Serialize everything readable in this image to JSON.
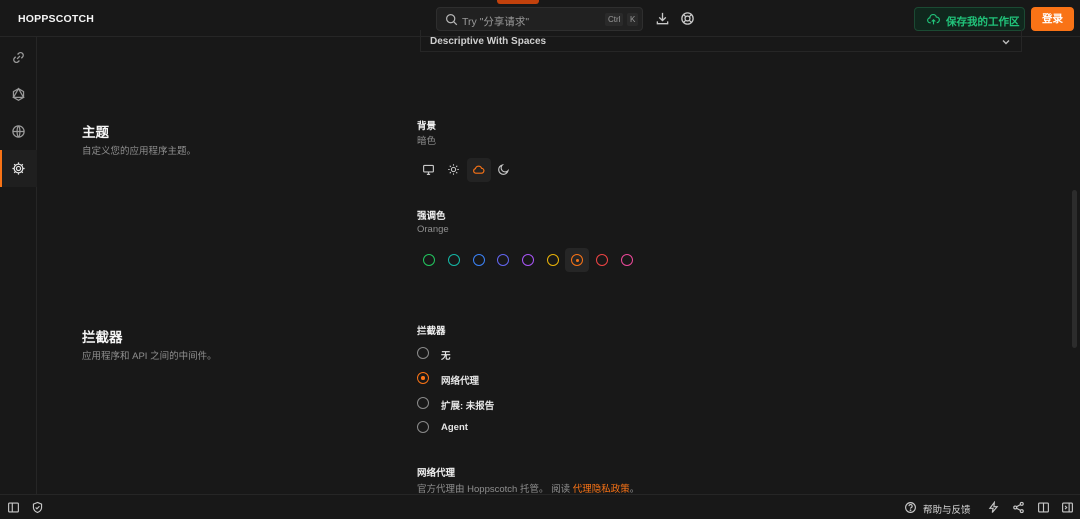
{
  "app": {
    "brand": "HOPPSCOTCH"
  },
  "header": {
    "search_placeholder": "Try \"分享请求\"",
    "shortcut_ctrl": "Ctrl",
    "shortcut_k": "K",
    "save_workspace": "保存我的工作区",
    "login": "登录"
  },
  "request_naming": {
    "value": "Descriptive With Spaces"
  },
  "theme": {
    "title": "主题",
    "description": "自定义您的应用程序主题。",
    "background_label": "背景",
    "background_value": "暗色",
    "background_options": [
      "monitor-icon",
      "sun-icon",
      "cloud-icon",
      "moon-icon"
    ],
    "background_selected": "cloud-icon",
    "accent_label": "强调色",
    "accent_value": "Orange",
    "accent_colors": [
      "#22c55e",
      "#14b8a6",
      "#3b82f6",
      "#6366f1",
      "#a855f7",
      "#eab308",
      "#f97316",
      "#ef4444",
      "#ec4899"
    ],
    "accent_selected": "#f97316"
  },
  "interceptor": {
    "title": "拦截器",
    "description": "应用程序和 API 之间的中间件。",
    "label": "拦截器",
    "options": [
      {
        "label": "无",
        "checked": false
      },
      {
        "label": "网络代理",
        "checked": true
      },
      {
        "label": "扩展: 未报告",
        "checked": false
      },
      {
        "label": "Agent",
        "checked": false
      }
    ],
    "proxy_title": "网络代理",
    "proxy_note": "官方代理由 Hoppscotch 托管。 阅读 ",
    "proxy_link": "代理隐私政策",
    "proxy_note_end": "。"
  },
  "footer": {
    "help": "帮助与反馈"
  },
  "colors": {
    "accent": "#f97316",
    "save_green": "#21c37a",
    "background": "#181818"
  }
}
